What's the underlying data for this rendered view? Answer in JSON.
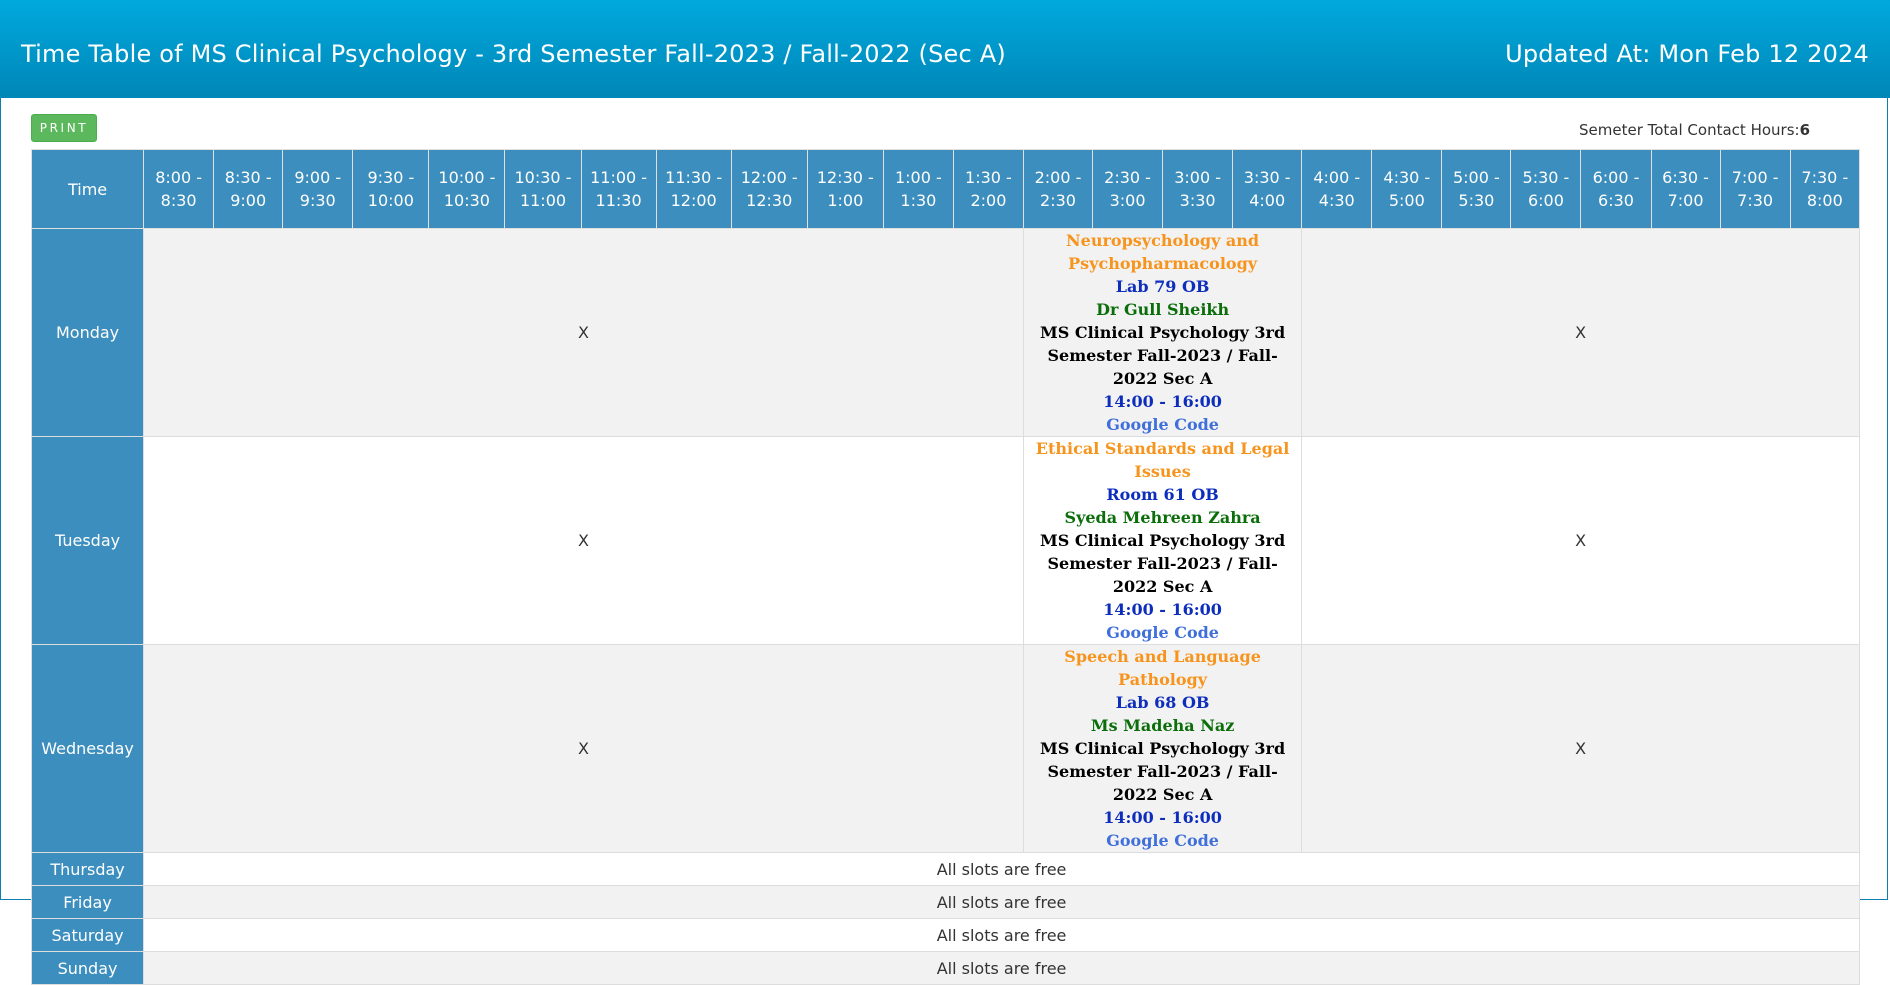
{
  "header": {
    "title": "Time Table of MS Clinical Psychology - 3rd Semester Fall-2023 / Fall-2022 (Sec A)",
    "updated": "Updated At: Mon Feb 12 2024"
  },
  "toolbar": {
    "print_label": "PRINT",
    "contact_label": "Semeter Total Contact Hours:",
    "contact_value": "6"
  },
  "table": {
    "time_header": "Time",
    "slots": [
      "8:00 - 8:30",
      "8:30 - 9:00",
      "9:00 - 9:30",
      "9:30 - 10:00",
      "10:00 - 10:30",
      "10:30 - 11:00",
      "11:00 - 11:30",
      "11:30 - 12:00",
      "12:00 - 12:30",
      "12:30 - 1:00",
      "1:00 - 1:30",
      "1:30 - 2:00",
      "2:00 - 2:30",
      "2:30 - 3:00",
      "3:00 - 3:30",
      "3:30 - 4:00",
      "4:00 - 4:30",
      "4:30 - 5:00",
      "5:00 - 5:30",
      "5:30 - 6:00",
      "6:00 - 6:30",
      "6:30 - 7:00",
      "7:00 - 7:30",
      "7:30 - 8:00"
    ],
    "empty_mark": "X",
    "free_text": "All slots are free",
    "days": {
      "monday": {
        "name": "Monday",
        "class": {
          "subject": "Neuropsychology and Psychopharmacology",
          "room": "Lab 79 OB",
          "teacher": "Dr Gull Sheikh",
          "section": "MS Clinical Psychology 3rd Semester Fall-2023 / Fall-2022 Sec A",
          "time": "14:00 - 16:00",
          "link": "Google Code"
        }
      },
      "tuesday": {
        "name": "Tuesday",
        "class": {
          "subject": "Ethical Standards and Legal Issues",
          "room": "Room 61 OB",
          "teacher": "Syeda Mehreen Zahra",
          "section": "MS Clinical Psychology 3rd Semester Fall-2023 / Fall-2022 Sec A",
          "time": "14:00 - 16:00",
          "link": "Google Code"
        }
      },
      "wednesday": {
        "name": "Wednesday",
        "class": {
          "subject": "Speech and Language Pathology",
          "room": "Lab 68 OB",
          "teacher": "Ms Madeha Naz",
          "section": "MS Clinical Psychology 3rd Semester Fall-2023 / Fall-2022 Sec A",
          "time": "14:00 - 16:00",
          "link": "Google Code"
        }
      },
      "thursday": {
        "name": "Thursday"
      },
      "friday": {
        "name": "Friday"
      },
      "saturday": {
        "name": "Saturday"
      },
      "sunday": {
        "name": "Sunday"
      }
    }
  },
  "colors": {
    "header_bg": "#0096c9",
    "table_header_bg": "#3c8ebe",
    "print_button": "#5cb85c",
    "subject": "#f7941d",
    "room": "#0d2dbd",
    "teacher": "#0b6e0b"
  }
}
